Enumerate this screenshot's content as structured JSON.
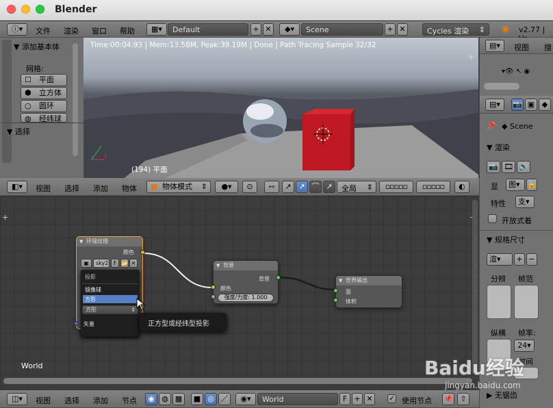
{
  "app": {
    "title": "Blender"
  },
  "top_bar": {
    "menus": [
      "文件",
      "渲染",
      "窗口",
      "帮助"
    ],
    "layout": "Default",
    "scene": "Scene",
    "engine": "Cycles 渲染",
    "version": "v2.77 | Ve"
  },
  "tool_shelf": {
    "header": "添加基本体",
    "mesh_label": "网格:",
    "items": [
      "平面",
      "立方体",
      "圆环",
      "经纬球"
    ],
    "select_header": "选择"
  },
  "viewport": {
    "stats": "Time:00:04.93 | Mem:13.58M, Peak:39.19M | Done | Path Tracing Sample 32/32",
    "object_label": "(194) 平面",
    "menus": [
      "视图",
      "选择",
      "添加",
      "物体"
    ],
    "mode": "物体模式",
    "pivot": "全局"
  },
  "node_editor": {
    "world_label": "World",
    "menus": [
      "视图",
      "选择",
      "添加",
      "节点"
    ],
    "world_field": "World",
    "fake_user": "F",
    "use_nodes": "使用节点"
  },
  "nodes": {
    "env": {
      "title": "环境纹理",
      "out_color": "颜色",
      "image": "sky2",
      "image_f": "F",
      "projection_label": "投影",
      "options": [
        "镜像球",
        "方形"
      ],
      "selected_value": "方形",
      "vector": "矢量"
    },
    "bg": {
      "title": "背景",
      "out": "背景",
      "in_color": "颜色",
      "strength": "强度/力度: 1.000"
    },
    "world": {
      "title": "世界输出",
      "surface": "面",
      "volume": "体积"
    }
  },
  "tooltip": "正方型或经纬型投影",
  "outliner": {
    "header": "视图",
    "search": "搜"
  },
  "properties": {
    "scene": "Scene",
    "render_header": "渲染",
    "display_label": "显",
    "display_value": "图",
    "feature_label": "特性",
    "feature_value": "支",
    "open_shading": "开放式着",
    "dimensions_header": "规格尺寸",
    "preset": "渲",
    "resolution_label": "分辨",
    "frame_label": "帧范",
    "aspect_label": "纵横",
    "fps_label": "帧率:",
    "fps_value": "24",
    "time_label": "时间",
    "anti_header": "无锯齿"
  },
  "watermark": "Baidu经验 jingyan.baidu.com"
}
